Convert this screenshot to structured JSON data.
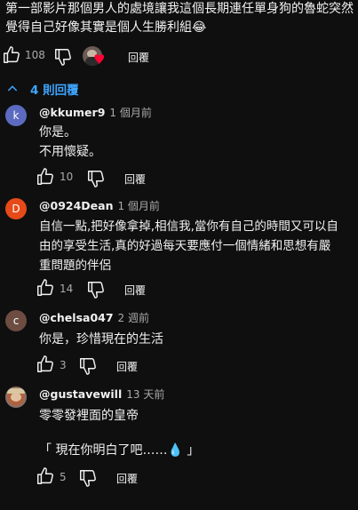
{
  "parent": {
    "text": "第一部影片那個男人的處境讓我這個長期連任單身狗的魯蛇突然覺得自己好像其實是個人生勝利組😂",
    "likes": "108",
    "reply_label": "回覆"
  },
  "replies_toggle": {
    "label": "4 則回覆"
  },
  "replies": [
    {
      "avatar_letter": "k",
      "avatar_color": "#5c6bc0",
      "handle": "@kkumer9",
      "time": "1 個月前",
      "lines": [
        "你是。",
        "不用懷疑。"
      ],
      "likes": "10",
      "reply_label": "回覆"
    },
    {
      "avatar_letter": "D",
      "avatar_color": "#e64a19",
      "handle": "@0924Dean",
      "time": "1 個月前",
      "lines": [
        "自信一點,把好像拿掉,相信我,當你有自己的時間又可以自",
        "由的享受生活,真的好過每天要應付一個情緒和思想有嚴",
        "重問題的伴侶"
      ],
      "likes": "14",
      "reply_label": "回覆"
    },
    {
      "avatar_letter": "c",
      "avatar_color": "#6d4c41",
      "handle": "@chelsa047",
      "time": "2 週前",
      "lines": [
        "你是，珍惜現在的生活"
      ],
      "likes": "3",
      "reply_label": "回覆"
    },
    {
      "avatar_letter": "",
      "avatar_color": "#8d6e63",
      "handle": "@gustavewill",
      "time": "13 天前",
      "lines": [
        "零零發裡面的皇帝",
        "",
        "「 現在你明白了吧……💧 」"
      ],
      "likes": "5",
      "reply_label": "回覆"
    }
  ],
  "colors": {
    "accent": "#3ea6ff",
    "heart": "#ff0033"
  }
}
